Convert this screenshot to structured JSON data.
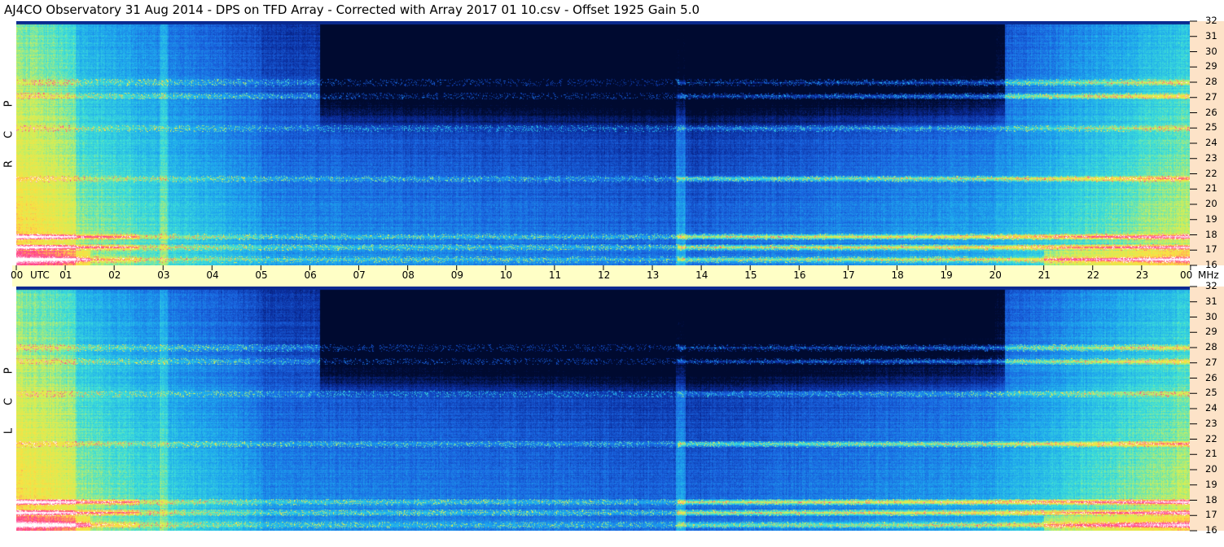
{
  "title": "AJ4CO Observatory  31 Aug 2014  -  DPS on TFD Array  -  Corrected with Array 2017 01 10.csv  -  Offset 1925  Gain 5.0",
  "chart_data": {
    "type": "heatmap",
    "x_unit": "UTC",
    "y_unit": "MHz",
    "x_ticks": [
      "00",
      "01",
      "02",
      "03",
      "04",
      "05",
      "06",
      "07",
      "08",
      "09",
      "10",
      "11",
      "12",
      "13",
      "14",
      "15",
      "16",
      "17",
      "18",
      "19",
      "20",
      "21",
      "22",
      "23",
      "00"
    ],
    "y_ticks": [
      "32",
      "31",
      "30",
      "29",
      "28",
      "27",
      "26",
      "25",
      "24",
      "23",
      "22",
      "21",
      "20",
      "19",
      "18",
      "17",
      "16"
    ],
    "xlim": [
      0,
      24
    ],
    "ylim": [
      16,
      32
    ],
    "panels": [
      {
        "name_letters": [
          "P",
          "C",
          "R"
        ],
        "polarization": "RCP"
      },
      {
        "name_letters": [
          "P",
          "C",
          "L"
        ],
        "polarization": "LCP"
      }
    ],
    "colormap": [
      "#000a30",
      "#0a2c9c",
      "#1a64e0",
      "#1ea8ee",
      "#3ee0d8",
      "#cfef5a",
      "#ffe040",
      "#ff3a8a",
      "#ffffff"
    ],
    "strong_emission_bands_mhz": [
      27.1,
      21.7,
      17.9,
      17.2,
      16.4,
      28.0
    ]
  },
  "labels": {
    "utc": "UTC",
    "mhz": "MHz"
  }
}
